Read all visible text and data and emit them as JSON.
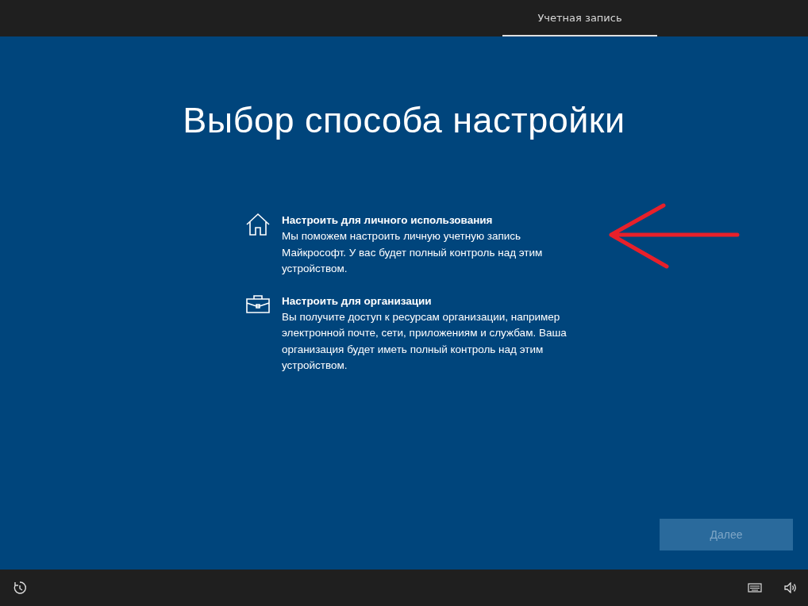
{
  "tabs": [
    {
      "label": "Учетная запись",
      "selected": true
    }
  ],
  "title": "Выбор способа настройки",
  "options": [
    {
      "kind": "home",
      "title": "Настроить для личного использования",
      "description": "Мы поможем настроить личную учетную запись Майкрософт. У вас будет полный контроль над этим устройством."
    },
    {
      "kind": "work",
      "title": "Настроить для организации",
      "description": "Вы получите доступ к ресурсам организации, например электронной почте, сети, приложениям и службам. Ваша организация будет иметь полный контроль над этим устройством."
    }
  ],
  "next_button": {
    "label": "Далее",
    "disabled": true
  }
}
